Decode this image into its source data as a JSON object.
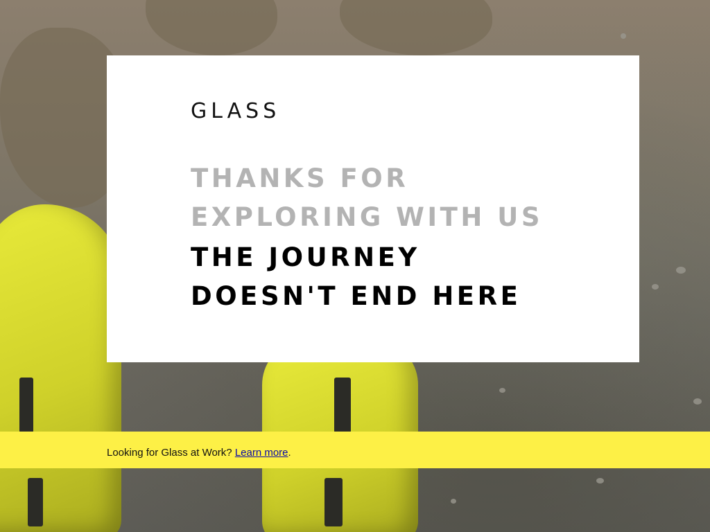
{
  "brand": {
    "logo_text": "GLASS"
  },
  "hero": {
    "headline_muted_line1": "THANKS FOR",
    "headline_muted_line2": "EXPLORING WITH US",
    "headline_strong_line1": "THE JOURNEY",
    "headline_strong_line2": "DOESN'T END HERE"
  },
  "banner": {
    "prefix": "Looking for Glass at Work?",
    "link_label": "Learn more",
    "suffix": "."
  },
  "colors": {
    "banner_background": "#fdf046",
    "headline_muted": "#b3b3b3",
    "headline_strong": "#000000",
    "card_background": "#ffffff"
  }
}
